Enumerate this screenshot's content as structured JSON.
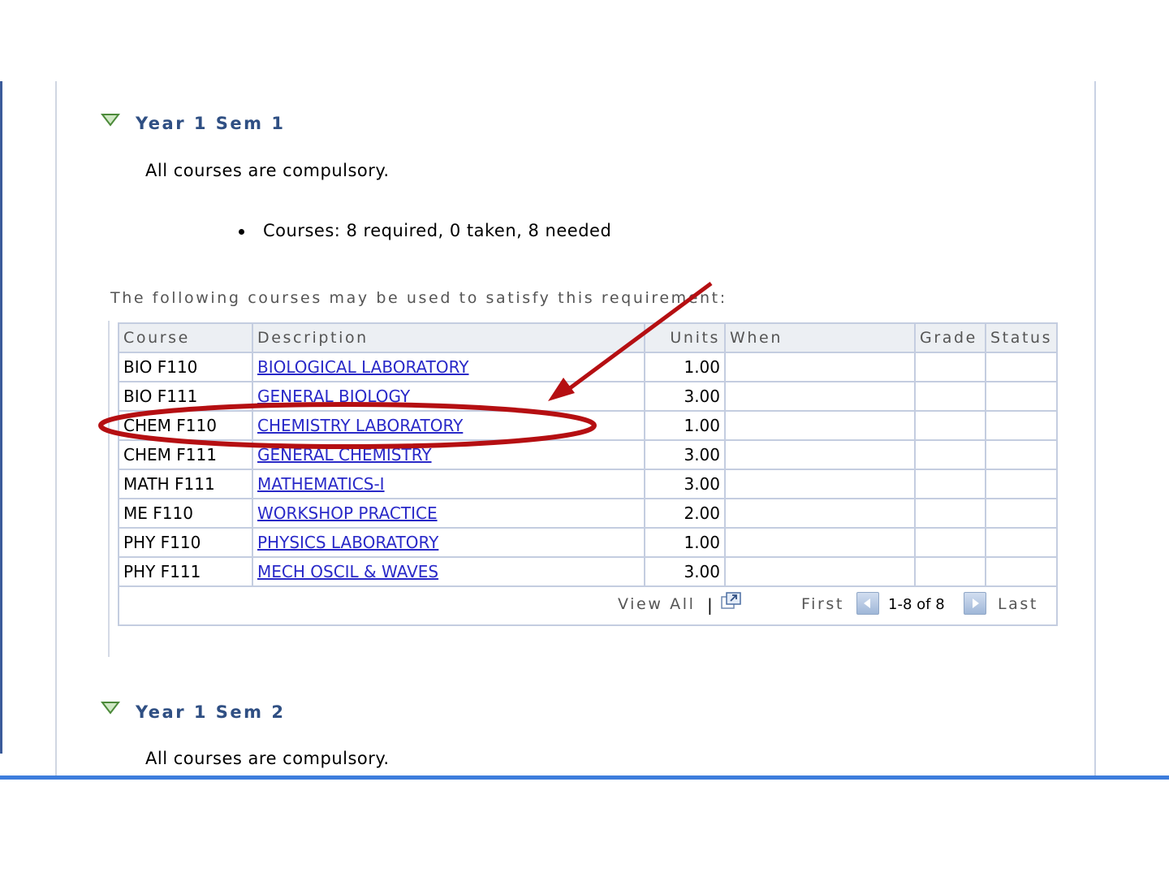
{
  "sections": [
    {
      "title": "Year 1 Sem 1",
      "note": "All courses are compulsory.",
      "summary": "Courses: 8 required, 0 taken, 8 needed",
      "caption": "The following courses may be used to satisfy this requirement:",
      "table": {
        "headers": {
          "course": "Course",
          "description": "Description",
          "units": "Units",
          "when": "When",
          "grade": "Grade",
          "status": "Status"
        },
        "rows": [
          {
            "course": "BIO F110",
            "description": "BIOLOGICAL LABORATORY",
            "units": "1.00",
            "when": "",
            "grade": "",
            "status": ""
          },
          {
            "course": "BIO F111",
            "description": "GENERAL BIOLOGY",
            "units": "3.00",
            "when": "",
            "grade": "",
            "status": ""
          },
          {
            "course": "CHEM F110",
            "description": "CHEMISTRY LABORATORY",
            "units": "1.00",
            "when": "",
            "grade": "",
            "status": ""
          },
          {
            "course": "CHEM F111",
            "description": "GENERAL CHEMISTRY",
            "units": "3.00",
            "when": "",
            "grade": "",
            "status": ""
          },
          {
            "course": "MATH F111",
            "description": "MATHEMATICS-I",
            "units": "3.00",
            "when": "",
            "grade": "",
            "status": ""
          },
          {
            "course": "ME F110",
            "description": "WORKSHOP PRACTICE",
            "units": "2.00",
            "when": "",
            "grade": "",
            "status": ""
          },
          {
            "course": "PHY F110",
            "description": "PHYSICS LABORATORY",
            "units": "1.00",
            "when": "",
            "grade": "",
            "status": ""
          },
          {
            "course": "PHY F111",
            "description": "MECH OSCIL & WAVES",
            "units": "3.00",
            "when": "",
            "grade": "",
            "status": ""
          }
        ],
        "footer": {
          "view_all": "View All",
          "separator": "|",
          "first": "First",
          "range": "1-8 of 8",
          "last": "Last"
        }
      }
    },
    {
      "title": "Year 1 Sem 2",
      "note": "All courses are compulsory."
    }
  ],
  "icons": {
    "section_toggle": "triangle-down-icon",
    "view_all": "popout-icon",
    "prev": "arrow-left-icon",
    "next": "arrow-right-icon"
  },
  "annotation": {
    "highlight_color": "#b50f12",
    "highlighted_row": "CHEM F110"
  },
  "colors": {
    "section_title": "#2f4f83",
    "link": "#2929c8",
    "grid_border": "#c4cde0",
    "header_bg": "#eceff3",
    "bottom_bar": "#3d7ddc"
  }
}
